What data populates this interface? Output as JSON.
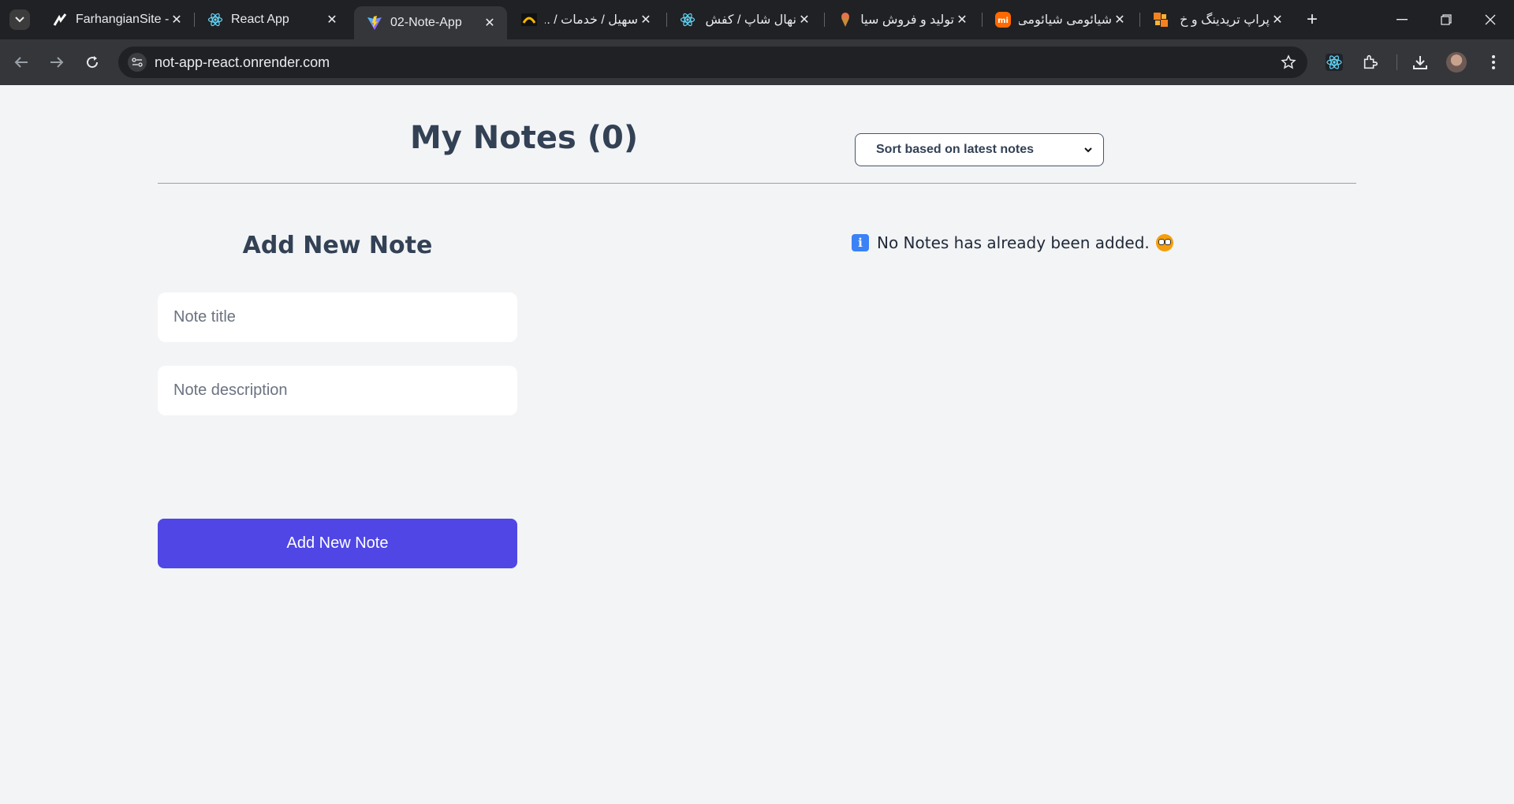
{
  "browser": {
    "tabs": [
      {
        "title": "FarhangianSite -",
        "icon": "farhangian-icon",
        "active": false
      },
      {
        "title": "React App",
        "icon": "react-icon",
        "active": false
      },
      {
        "title": "02-Note-App",
        "icon": "vite-icon",
        "active": true
      },
      {
        "title": "سهیل / خدمات / ...",
        "icon": "soheil-icon",
        "active": false
      },
      {
        "title": "نهال شاپ / کفش",
        "icon": "react-icon",
        "active": false
      },
      {
        "title": "تولید و فروش سیا",
        "icon": "ice-cream-icon",
        "active": false
      },
      {
        "title": "شیائومی شیائومی",
        "icon": "mi-icon",
        "active": false
      },
      {
        "title": "پراپ تریدینگ و خ",
        "icon": "prop-icon",
        "active": false
      }
    ],
    "url": "not-app-react.onrender.com"
  },
  "app": {
    "title": "My Notes (0)",
    "sort": {
      "selected": "Sort based on latest notes"
    },
    "form": {
      "heading": "Add New Note",
      "title_placeholder": "Note title",
      "description_placeholder": "Note description",
      "submit_label": "Add New Note"
    },
    "empty_message": "No Notes has already been added.",
    "accent_color": "#4f46e5"
  }
}
